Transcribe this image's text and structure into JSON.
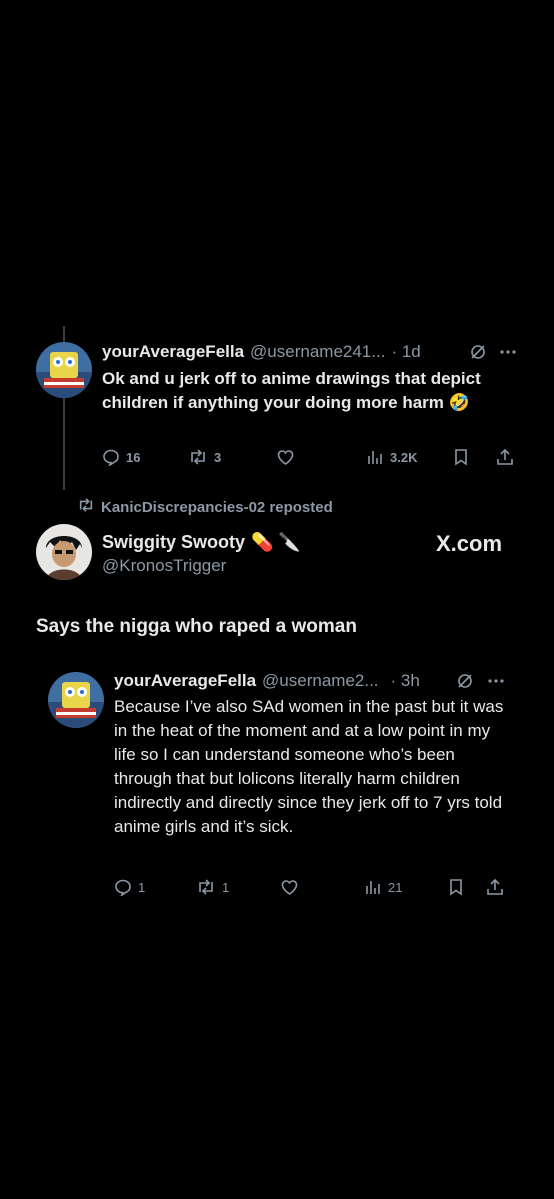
{
  "tweet1": {
    "name": "yourAverageFella",
    "handle": "@username241...",
    "time": "· 1d",
    "text": "Ok and u jerk off to anime drawings that depict children if anything your doing more harm 🤣",
    "replies": "16",
    "reposts": "3",
    "views": "3.2K"
  },
  "repost_banner": {
    "text": "KanicDiscrepancies-02 reposted"
  },
  "main_tweet": {
    "name": "Swiggity Swooty",
    "name_emoji": "💊 🔪",
    "handle": "@KronosTrigger",
    "badge": "X.com",
    "text": "Says the nigga who raped a woman"
  },
  "tweet2": {
    "name": "yourAverageFella",
    "handle": "@username2...",
    "time": "· 3h",
    "text": "Because I’ve also SAd women in the past but it was in the heat of the moment and at a low point in my life so I can understand someone who’s been through that but lolicons literally harm children indirectly and directly since they jerk off to 7 yrs told anime girls and it’s sick.",
    "replies": "1",
    "reposts": "1",
    "views": "21"
  },
  "icons": [
    "reply-icon",
    "repost-icon",
    "like-icon",
    "views-icon",
    "bookmark-icon",
    "share-icon",
    "grok-icon",
    "more-icon"
  ]
}
